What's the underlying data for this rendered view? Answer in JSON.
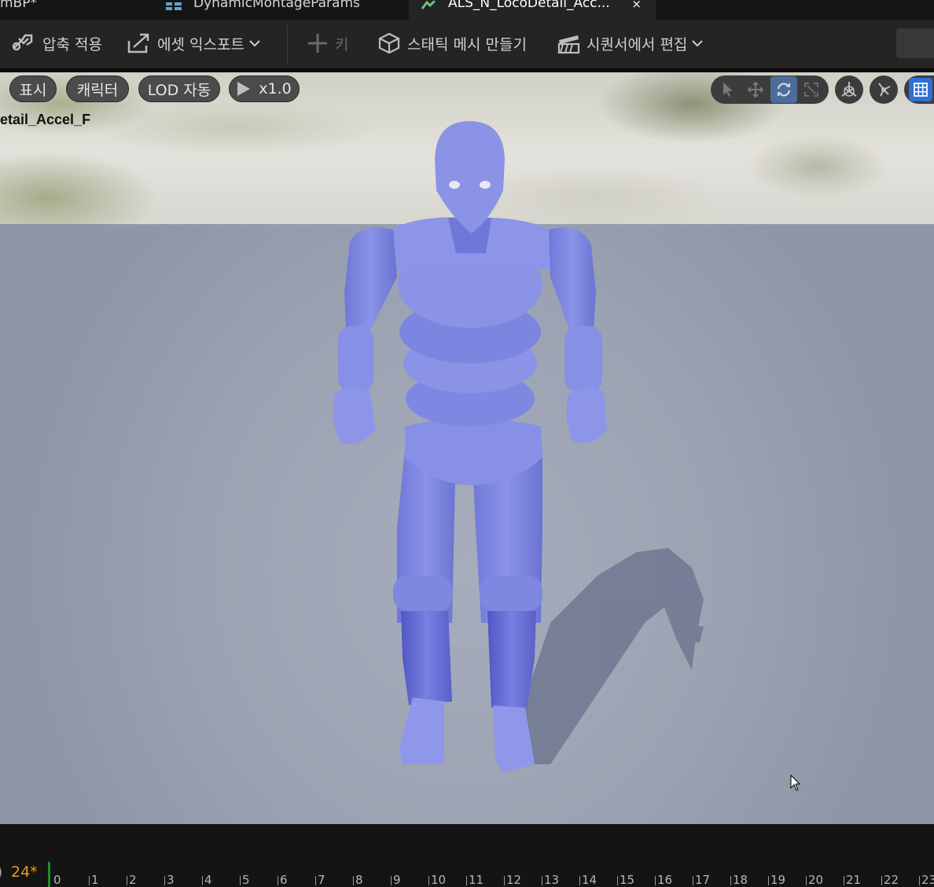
{
  "tabs": [
    {
      "label": "mBP*",
      "icon": "blueprint-icon"
    },
    {
      "label": "DynamicMontageParams",
      "icon": "struct-icon"
    },
    {
      "label": "ALS_N_LocoDetail_Acc...",
      "icon": "animation-icon",
      "active": true,
      "close": "×"
    }
  ],
  "toolbar": {
    "apply_compression": "압축 적용",
    "export_asset": "에셋 익스포트",
    "key": "키",
    "make_static_mesh": "스태틱 메시 만들기",
    "edit_in_sequencer": "시퀀서에서 편집"
  },
  "viewport": {
    "show": "표시",
    "character": "캐릭터",
    "lod": "LOD 자동",
    "speed": "x1.0",
    "anim_name": "etail_Accel_F",
    "tools": [
      "select-icon",
      "translate-icon",
      "rotate-icon",
      "scale-icon"
    ],
    "active_tool": "rotate-icon",
    "accent": "#4d6c98",
    "mannequin_color": "#8a93e6"
  },
  "timeline": {
    "frame_rate": "24*",
    "paren": ")",
    "ticks": [
      "0",
      "1",
      "2",
      "3",
      "4",
      "5",
      "6",
      "7",
      "8",
      "9",
      "10",
      "11",
      "12",
      "13",
      "14",
      "15",
      "16",
      "17",
      "18",
      "19",
      "20",
      "21",
      "22",
      "23"
    ],
    "playhead_color": "#1f8d2c"
  }
}
